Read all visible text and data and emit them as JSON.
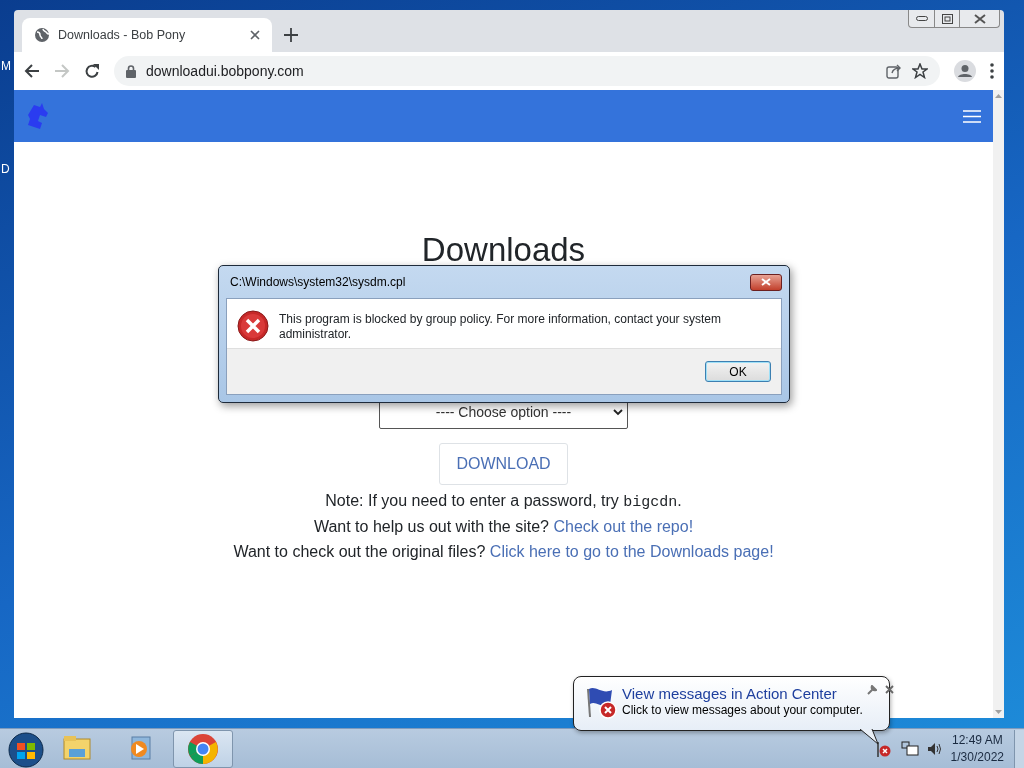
{
  "desktop": {
    "icon_labels": [
      "M",
      "D"
    ]
  },
  "browser": {
    "tab_title": "Downloads - Bob Pony",
    "address": "downloadui.bobpony.com",
    "forward_disabled": true
  },
  "page": {
    "heading": "Downloads",
    "select_value": "---- Choose option ----",
    "button": "DOWNLOAD",
    "note": {
      "text": "Note: If you need to enter a password, try ",
      "code": "bigcdn",
      "end": "."
    },
    "lines": [
      {
        "text": "Want to help us out with the site? ",
        "link": "Check out the repo!"
      },
      {
        "text": "Want to check out the original files? ",
        "link": "Click here to go to the Downloads page!"
      }
    ]
  },
  "dialog": {
    "title": "C:\\Windows\\system32\\sysdm.cpl",
    "message": "This program is blocked by group policy. For more information, contact your system administrator.",
    "buttons": [
      "OK"
    ]
  },
  "balloon": {
    "title": "View messages in Action Center",
    "message": "Click to view messages about your computer."
  },
  "taskbar": {
    "apps": [
      {
        "kind": "explorer",
        "selected": false
      },
      {
        "kind": "media",
        "selected": false
      },
      {
        "kind": "chrome",
        "selected": true
      }
    ],
    "clock": {
      "time": "12:49 AM",
      "date": "1/30/2022"
    }
  }
}
